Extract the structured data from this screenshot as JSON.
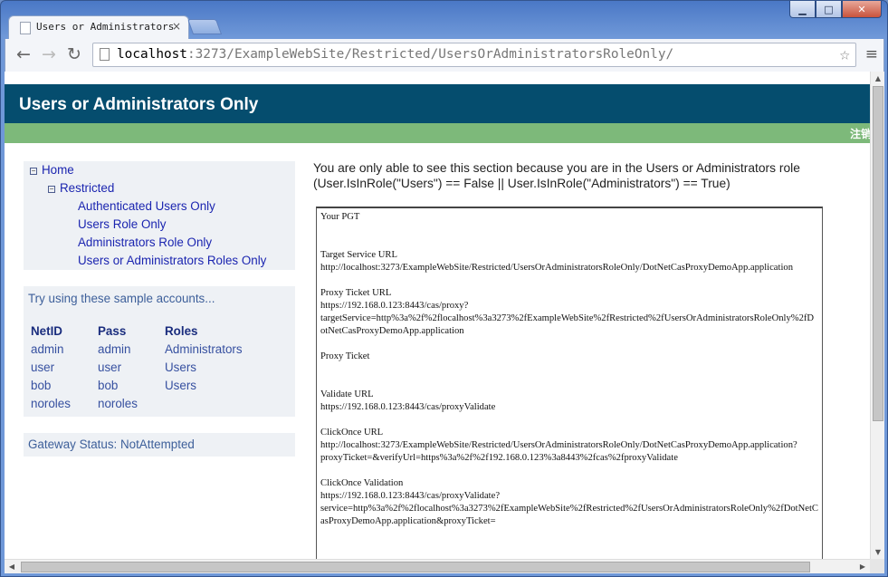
{
  "browser": {
    "tab_title": "Users or Administrators",
    "tab_close": "×",
    "url_host": "localhost",
    "url_rest": ":3273/ExampleWebSite/Restricted/UsersOrAdministratorsRoleOnly/",
    "window_controls": {
      "minimize": "▁",
      "maximize": "□",
      "close": "✕"
    },
    "nav": {
      "back": "←",
      "forward": "→",
      "reload": "↻"
    },
    "star": "☆",
    "menu": "≡"
  },
  "header": {
    "title": "Users or Administrators Only"
  },
  "greenbar": {
    "logout": "注销"
  },
  "tree": {
    "home": "Home",
    "restricted": "Restricted",
    "items": [
      "Authenticated Users Only",
      "Users Role Only",
      "Administrators Role Only",
      "Users or Administrators Roles Only"
    ]
  },
  "accounts": {
    "hint": "Try using these sample accounts...",
    "headers": [
      "NetID",
      "Pass",
      "Roles"
    ],
    "rows": [
      [
        "admin",
        "admin",
        "Administrators"
      ],
      [
        "user",
        "user",
        "Users"
      ],
      [
        "bob",
        "bob",
        "Users"
      ],
      [
        "noroles",
        "noroles",
        ""
      ]
    ]
  },
  "gateway": {
    "text": "Gateway Status: NotAttempted"
  },
  "main": {
    "intro": "You are only able to see this section because you are in the Users or Administrators role (User.IsInRole(\"Users\") == False || User.IsInRole(\"Administrators\") == True)",
    "pgt_text": "Your PGT\n\n\nTarget Service URL\nhttp://localhost:3273/ExampleWebSite/Restricted/UsersOrAdministratorsRoleOnly/DotNetCasProxyDemoApp.application\n\nProxy Ticket URL\nhttps://192.168.0.123:8443/cas/proxy?\ntargetService=http%3a%2f%2flocalhost%3a3273%2fExampleWebSite%2fRestricted%2fUsersOrAdministratorsRoleOnly%2fDotNetCasProxyDemoApp.application\n\nProxy Ticket\n\n\nValidate URL\nhttps://192.168.0.123:8443/cas/proxyValidate\n\nClickOnce URL\nhttp://localhost:3273/ExampleWebSite/Restricted/UsersOrAdministratorsRoleOnly/DotNetCasProxyDemoApp.application?\nproxyTicket=&verifyUrl=https%3a%2f%2f192.168.0.123%3a8443%2fcas%2fproxyValidate\n\nClickOnce Validation\nhttps://192.168.0.123:8443/cas/proxyValidate?\nservice=http%3a%2f%2flocalhost%3a3273%2fExampleWebSite%2fRestricted%2fUsersOrAdministratorsRoleOnly%2fDotNetCasProxyDemoApp.application&proxyTicket="
  }
}
